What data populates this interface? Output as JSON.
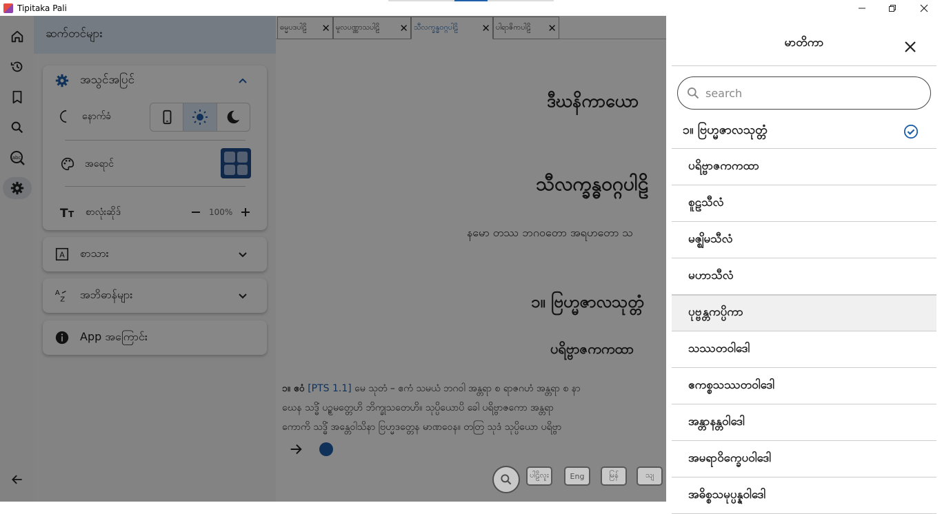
{
  "window": {
    "title": "Tipitaka Pali"
  },
  "nav_rail": {
    "items": [
      {
        "icon": "home-icon"
      },
      {
        "icon": "history-icon"
      },
      {
        "icon": "bookmark-icon"
      },
      {
        "icon": "search-icon"
      },
      {
        "icon": "dictionary-icon"
      },
      {
        "icon": "settings-icon",
        "active": true
      }
    ],
    "back_icon": "arrow-back-icon"
  },
  "settings": {
    "title": "ဆက်တင်များ",
    "appearance": {
      "title": "အသွင်အပြင်",
      "background_label": "နောက်ခံ",
      "theme_options": [
        "system",
        "light",
        "dark"
      ],
      "selected_theme": "light",
      "color_label": "အရောင်",
      "font_size_label": "စာလုံးဆိုဒ်",
      "font_size_value": "100%"
    },
    "script_section": "စာသား",
    "dictionary_section": "အဘိဓာန်များ",
    "about_section": "App အကြောင်း"
  },
  "tabs": [
    {
      "label": "ဓမ္မပဒပါဠိ"
    },
    {
      "label": "မူလပဏ္ဏာသပါဠိ"
    },
    {
      "label": "သီလက္ခန္ဓဝဂ္ဂပါဠိ",
      "active": true
    },
    {
      "label": "ပါရာဇိကပါဠိ"
    }
  ],
  "reader": {
    "nikaya": "ဒီဃနိကာယော",
    "book": "သီလက္ခန္ဓဝဂ္ဂပါဠိ",
    "namo": "နမော တဿ ဘဂဝတော အရဟတော သ",
    "sutta": "၁။ ဗြဟ္မဇာလသုတ္တံ",
    "section": "ပရိဗ္ဗာဇကကထာ",
    "para_num": "၁။ ဧဝံ",
    "pts": "[PTS 1.1]",
    "line1_rest": "မေ သုတံ – ဧကံ သမယံ ဘဂဝါ အန္တရာ စ ရာဇဂဟံ အန္တရာ စ နာ",
    "line2": "ဃေန သဒ္ဓိံ ပဉ္စမတ္တေဟိ ဘိက္ခုသတေဟိ။ သုပ္ပိယောပိ ခေါ ပရိဗ္ဗာဇကော အန္တရာ",
    "line3": "ကောကိ သဒ္ဓိံ အန္တေဝါသိနာ ဗြဟ္မဒတ္တေန မာဏဝေန။ တတြ သုဒံ သုပ္ပိယော ပရိဗ္ဗာ",
    "bottom_buttons": [
      "ပါဠိလူး",
      "Eng",
      "မြန်",
      "သျ"
    ]
  },
  "toc": {
    "title": "မာတိကာ",
    "search_placeholder": "search",
    "items": [
      {
        "label": "၁။ ဗြဟ္မဇာလသုတ္တံ",
        "checked": true
      },
      {
        "label": "ပရိဗ္ဗာဇကကထာ"
      },
      {
        "label": "စူဠသီလံ"
      },
      {
        "label": "မဇ္ဈိမသီလံ"
      },
      {
        "label": "မဟာသီလံ"
      },
      {
        "label": "ပုဗ္ဗန္တကပ္ပိကာ",
        "highlighted": true
      },
      {
        "label": "သဿတဝါဒေါ"
      },
      {
        "label": "ဧကစ္စသဿတဝါဒေါ"
      },
      {
        "label": "အန္တာနန္တဝါဒေါ"
      },
      {
        "label": "အမရာဝိက္ခေပဝါဒေါ"
      },
      {
        "label": "အဓိစ္စသမုပ္ပန္နဝါဒေါ"
      }
    ]
  },
  "colors": {
    "accent": "#1f5ea8",
    "scrim": "#000000"
  }
}
